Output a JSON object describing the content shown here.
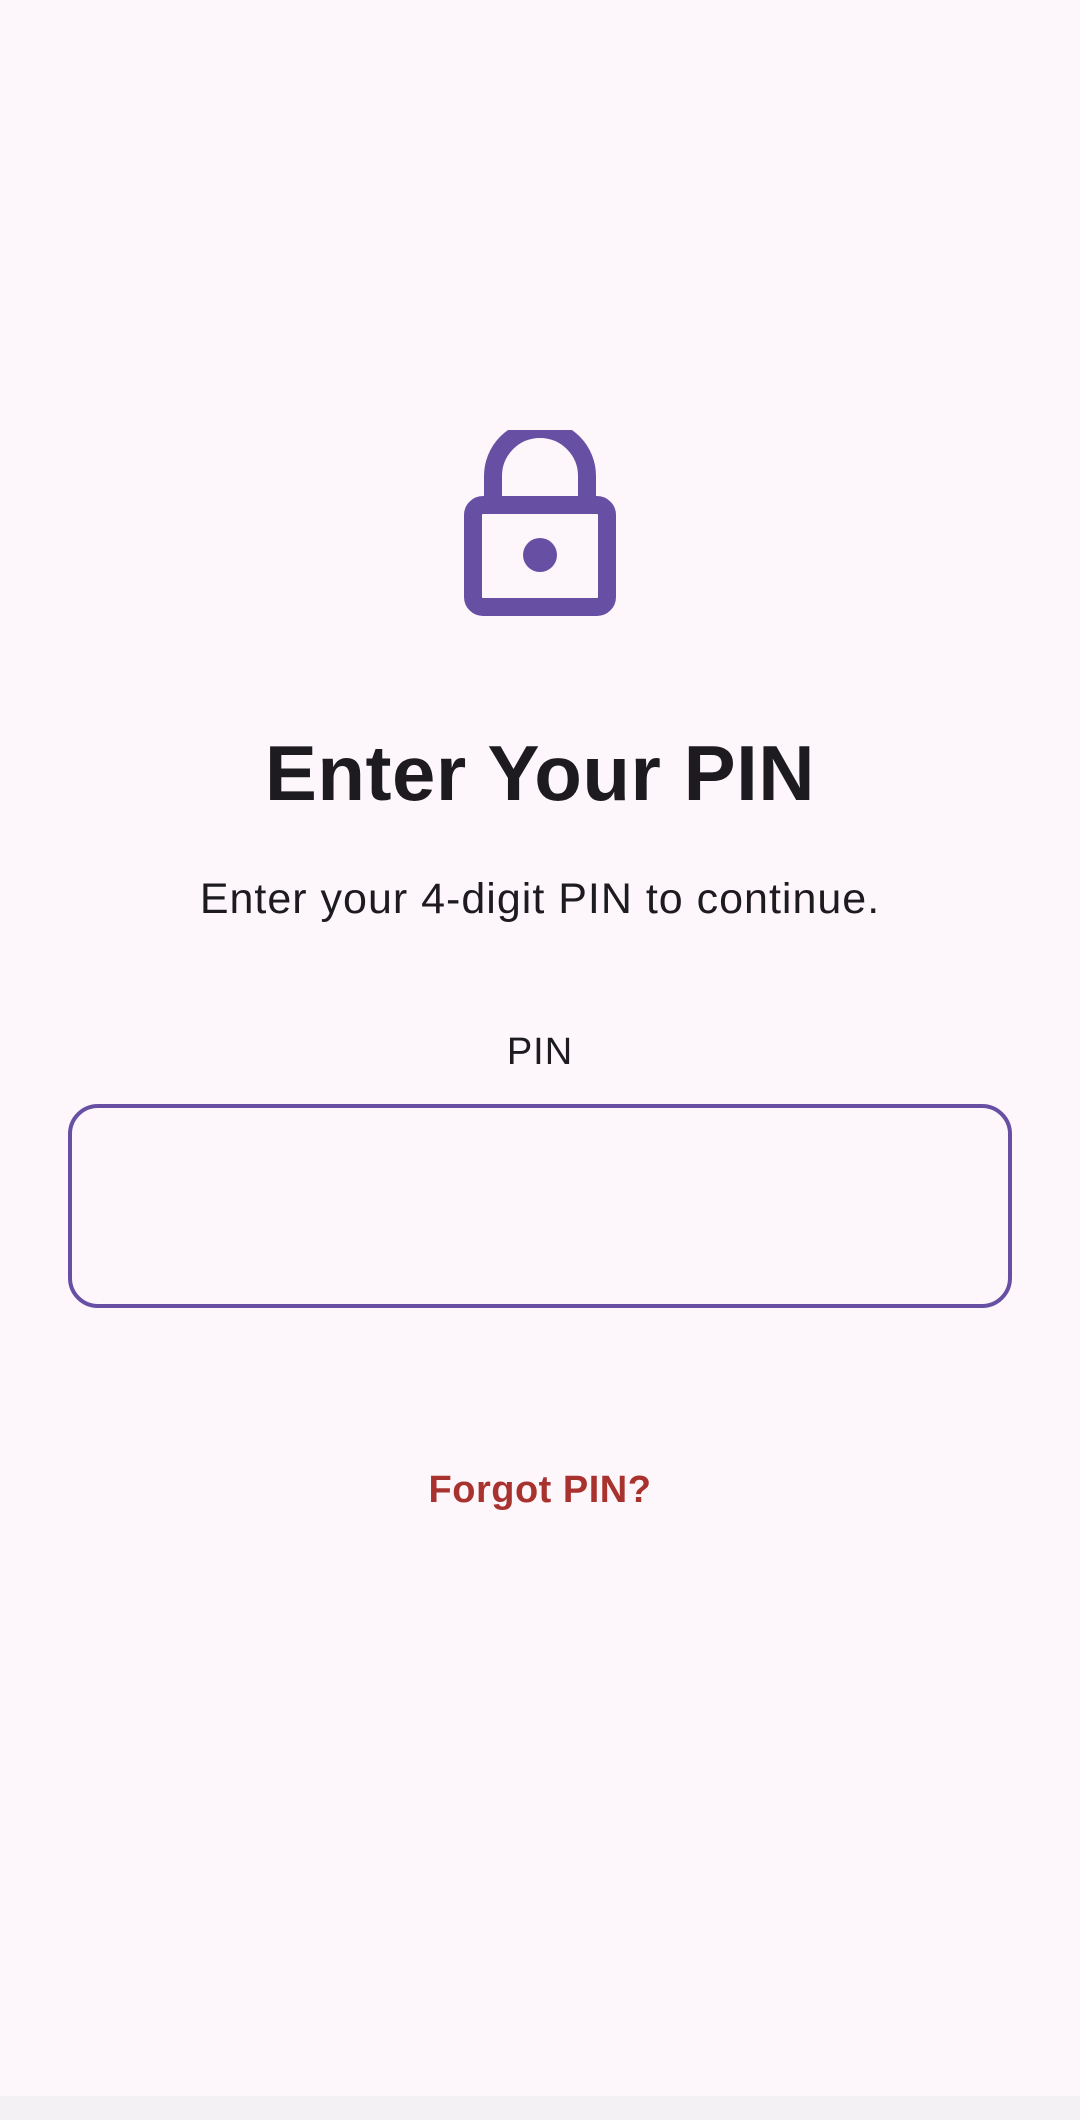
{
  "screen": {
    "title": "Enter Your PIN",
    "subtitle": "Enter your 4-digit PIN to continue.",
    "icon": "lock-icon"
  },
  "pin_field": {
    "label": "PIN",
    "value": ""
  },
  "actions": {
    "forgot_label": "Forgot PIN?"
  },
  "colors": {
    "background": "#fdf7fc",
    "accent": "#6750a4",
    "text": "#1d1b20",
    "link": "#a8322e"
  }
}
